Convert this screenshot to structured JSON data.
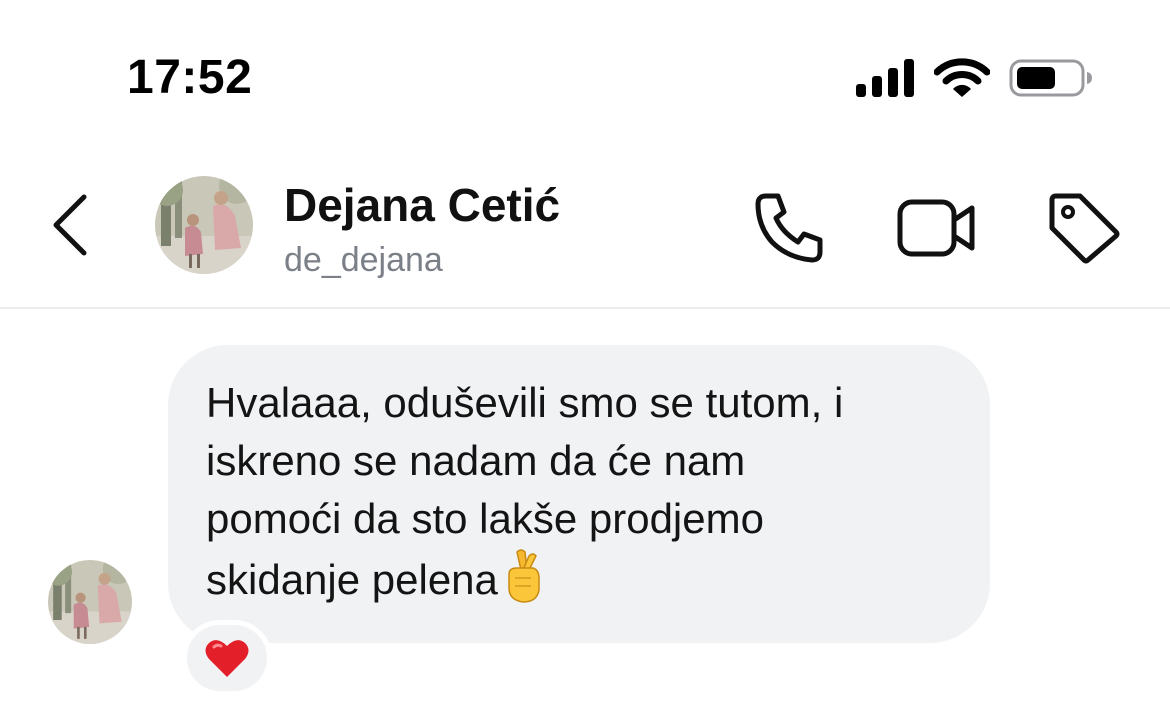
{
  "status_bar": {
    "time": "17:52",
    "signal_icon": "cellular-signal-icon",
    "wifi_icon": "wifi-icon",
    "battery_icon": "battery-icon"
  },
  "header": {
    "back_icon": "chevron-left-icon",
    "contact_name": "Dejana Cetić",
    "contact_handle": "de_dejana",
    "actions": [
      {
        "name": "call",
        "icon": "phone-icon"
      },
      {
        "name": "video",
        "icon": "video-camera-icon"
      },
      {
        "name": "tag",
        "icon": "tag-icon"
      }
    ]
  },
  "message": {
    "lines": [
      "Hvalaaa, oduševili smo se tutom, i",
      "iskreno se nadam da će nam",
      "pomoći da sto lakše prodjemo",
      "skidanje pelena"
    ],
    "emoji": "crossed-fingers-emoji",
    "reaction": "red-heart-emoji"
  },
  "colors": {
    "bubble": "#f1f2f4",
    "handle_text": "#7b7f87",
    "divider": "#ececee",
    "heart": "#e3202a"
  }
}
